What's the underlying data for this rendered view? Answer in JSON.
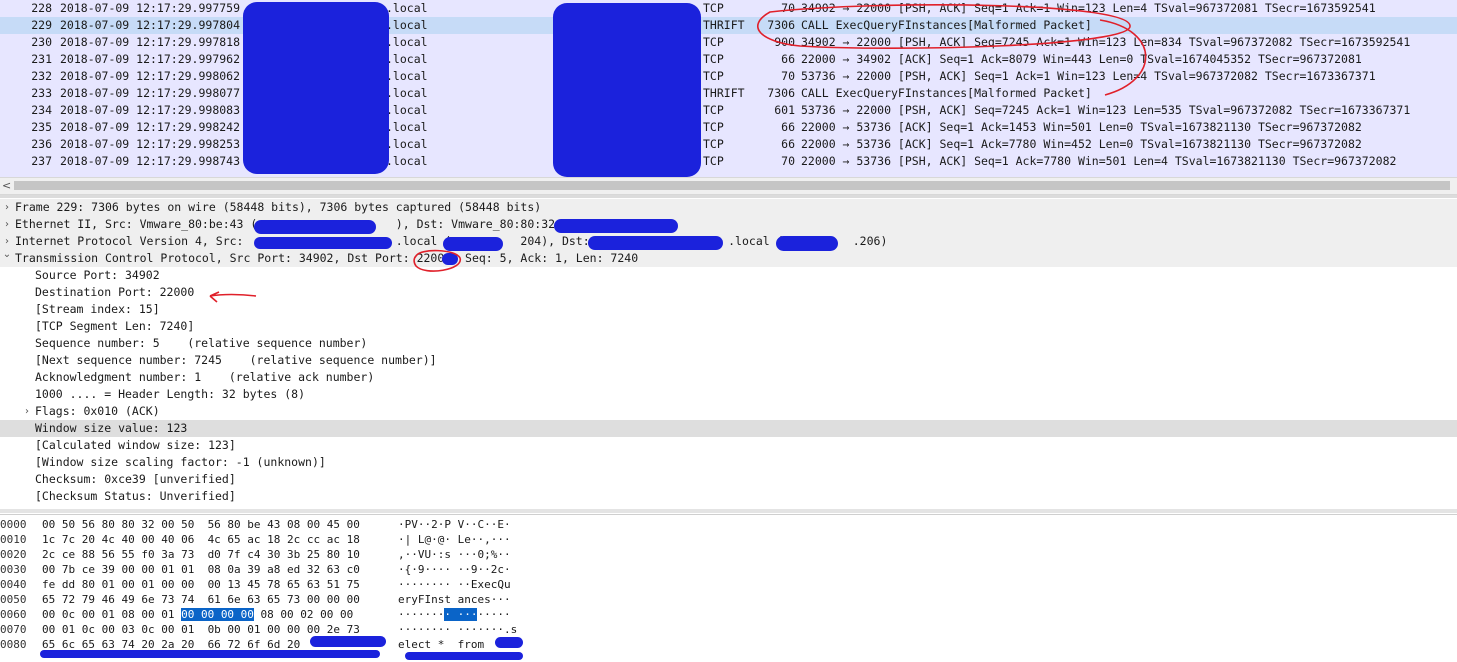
{
  "packet_list": {
    "rows": [
      {
        "no": "228",
        "time": "2018-07-09 12:17:29.997759",
        "src": ".local",
        "proto": "TCP",
        "len": "70",
        "info": "34902 → 22000 [PSH, ACK] Seq=1 Ack=1 Win=123 Len=4 TSval=967372081 TSecr=1673592541",
        "selected": false
      },
      {
        "no": "229",
        "time": "2018-07-09 12:17:29.997804",
        "src": ".local",
        "proto": "THRIFT",
        "len": "7306",
        "info": "CALL ExecQueryFInstances[Malformed Packet]",
        "selected": true
      },
      {
        "no": "230",
        "time": "2018-07-09 12:17:29.997818",
        "src": ".local",
        "proto": "TCP",
        "len": "900",
        "info": "34902 → 22000 [PSH, ACK] Seq=7245 Ack=1 Win=123 Len=834 TSval=967372082 TSecr=1673592541",
        "selected": false
      },
      {
        "no": "231",
        "time": "2018-07-09 12:17:29.997962",
        "src": ".local",
        "proto": "TCP",
        "len": "66",
        "info": "22000 → 34902 [ACK] Seq=1 Ack=8079 Win=443 Len=0 TSval=1674045352 TSecr=967372081",
        "selected": false
      },
      {
        "no": "232",
        "time": "2018-07-09 12:17:29.998062",
        "src": ".local",
        "proto": "TCP",
        "len": "70",
        "info": "53736 → 22000 [PSH, ACK] Seq=1 Ack=1 Win=123 Len=4 TSval=967372082 TSecr=1673367371",
        "selected": false
      },
      {
        "no": "233",
        "time": "2018-07-09 12:17:29.998077",
        "src": ".local",
        "proto": "THRIFT",
        "len": "7306",
        "info": "CALL ExecQueryFInstances[Malformed Packet]",
        "selected": false
      },
      {
        "no": "234",
        "time": "2018-07-09 12:17:29.998083",
        "src": ".local",
        "proto": "TCP",
        "len": "601",
        "info": "53736 → 22000 [PSH, ACK] Seq=7245 Ack=1 Win=123 Len=535 TSval=967372082 TSecr=1673367371",
        "selected": false
      },
      {
        "no": "235",
        "time": "2018-07-09 12:17:29.998242",
        "src": ".local",
        "proto": "TCP",
        "len": "66",
        "info": "22000 → 53736 [ACK] Seq=1 Ack=1453 Win=501 Len=0 TSval=1673821130 TSecr=967372082",
        "selected": false
      },
      {
        "no": "236",
        "time": "2018-07-09 12:17:29.998253",
        "src": ".local",
        "proto": "TCP",
        "len": "66",
        "info": "22000 → 53736 [ACK] Seq=1 Ack=7780 Win=452 Len=0 TSval=1673821130 TSecr=967372082",
        "selected": false
      },
      {
        "no": "237",
        "time": "2018-07-09 12:17:29.998743",
        "src": ".local",
        "proto": "TCP",
        "len": "70",
        "info": "22000 → 53736 [PSH, ACK] Seq=1 Ack=7780 Win=501 Len=4 TSval=1673821130 TSecr=967372082",
        "selected": false
      }
    ]
  },
  "details": {
    "rows": [
      {
        "level": 0,
        "expander": "collapsed",
        "text": "Frame 229: 7306 bytes on wire (58448 bits), 7306 bytes captured (58448 bits)",
        "style": "top"
      },
      {
        "level": 0,
        "expander": "collapsed",
        "text": "Ethernet II, Src: Vmware_80:be:43 (                    ), Dst: Vmware_80:80:32 (",
        "style": "top"
      },
      {
        "level": 0,
        "expander": "collapsed",
        "text": "Internet Protocol Version 4, Src:                      .local (          204), Dst:                    .local (          .206)",
        "style": "top"
      },
      {
        "level": 0,
        "expander": "expanded",
        "text": "Transmission Control Protocol, Src Port: 34902, Dst Port: 22000, Seq: 5, Ack: 1, Len: 7240",
        "style": "top"
      },
      {
        "level": 1,
        "expander": "none",
        "text": "Source Port: 34902",
        "style": ""
      },
      {
        "level": 1,
        "expander": "none",
        "text": "Destination Port: 22000",
        "style": ""
      },
      {
        "level": 1,
        "expander": "none",
        "text": "[Stream index: 15]",
        "style": ""
      },
      {
        "level": 1,
        "expander": "none",
        "text": "[TCP Segment Len: 7240]",
        "style": ""
      },
      {
        "level": 1,
        "expander": "none",
        "text": "Sequence number: 5    (relative sequence number)",
        "style": ""
      },
      {
        "level": 1,
        "expander": "none",
        "text": "[Next sequence number: 7245    (relative sequence number)]",
        "style": ""
      },
      {
        "level": 1,
        "expander": "none",
        "text": "Acknowledgment number: 1    (relative ack number)",
        "style": ""
      },
      {
        "level": 1,
        "expander": "none",
        "text": "1000 .... = Header Length: 32 bytes (8)",
        "style": ""
      },
      {
        "level": 1,
        "expander": "collapsed",
        "text": "Flags: 0x010 (ACK)",
        "style": ""
      },
      {
        "level": 1,
        "expander": "none",
        "text": "Window size value: 123",
        "style": "hl"
      },
      {
        "level": 1,
        "expander": "none",
        "text": "[Calculated window size: 123]",
        "style": ""
      },
      {
        "level": 1,
        "expander": "none",
        "text": "[Window size scaling factor: -1 (unknown)]",
        "style": ""
      },
      {
        "level": 1,
        "expander": "none",
        "text": "Checksum: 0xce39 [unverified]",
        "style": ""
      },
      {
        "level": 1,
        "expander": "none",
        "text": "[Checksum Status: Unverified]",
        "style": ""
      }
    ]
  },
  "bytes": {
    "rows": [
      {
        "off": "0000",
        "hex_pre": "00 50 56 80 80 32 00 50  56 80 be 43 08 00 45 00",
        "hex_sel": "",
        "hex_post": "",
        "ascii_pre": "·PV··2·P V··C··E·",
        "ascii_sel": "",
        "ascii_post": ""
      },
      {
        "off": "0010",
        "hex_pre": "1c 7c 20 4c 40 00 40 06  4c 65 ac 18 2c cc ac 18",
        "hex_sel": "",
        "hex_post": "",
        "ascii_pre": "·| L@·@· Le··,···",
        "ascii_sel": "",
        "ascii_post": ""
      },
      {
        "off": "0020",
        "hex_pre": "2c ce 88 56 55 f0 3a 73  d0 7f c4 30 3b 25 80 10",
        "hex_sel": "",
        "hex_post": "",
        "ascii_pre": ",··VU·:s ···0;%··",
        "ascii_sel": "",
        "ascii_post": ""
      },
      {
        "off": "0030",
        "hex_pre": "00 7b ce 39 00 00 01 01  08 0a 39 a8 ed 32 63 c0",
        "hex_sel": "",
        "hex_post": "",
        "ascii_pre": "·{·9···· ··9··2c·",
        "ascii_sel": "",
        "ascii_post": ""
      },
      {
        "off": "0040",
        "hex_pre": "fe dd 80 01 00 01 00 00  00 13 45 78 65 63 51 75",
        "hex_sel": "",
        "hex_post": "",
        "ascii_pre": "········ ··ExecQu",
        "ascii_sel": "",
        "ascii_post": ""
      },
      {
        "off": "0050",
        "hex_pre": "65 72 79 46 49 6e 73 74  61 6e 63 65 73 00 00 00",
        "hex_sel": "",
        "hex_post": "",
        "ascii_pre": "eryFInst ances···",
        "ascii_sel": "",
        "ascii_post": ""
      },
      {
        "off": "0060",
        "hex_pre": "00 0c 00 01 08 00 01 ",
        "hex_sel": "00 00 00 00",
        "hex_post": " 08 00 02 00 00",
        "ascii_pre": "·······",
        "ascii_sel": "· ···",
        "ascii_post": "·····"
      },
      {
        "off": "0070",
        "hex_pre": "00 01 0c 00 03 0c 00 01  0b 00 01 00 00 00 2e 73",
        "hex_sel": "",
        "hex_post": "",
        "ascii_pre": "········ ·······.s",
        "ascii_sel": "",
        "ascii_post": ""
      },
      {
        "off": "0080",
        "hex_pre": "65 6c 65 63 74 20 2a 20  66 72 6f 6d 20",
        "hex_sel": "",
        "hex_post": "",
        "ascii_pre": "elect *  from",
        "ascii_sel": "",
        "ascii_post": ""
      }
    ]
  },
  "colors": {
    "selected_row": "#c6dbf7",
    "list_bg": "#e7e6ff",
    "redaction": "#1b22dc",
    "annotation": "#e0202a"
  }
}
